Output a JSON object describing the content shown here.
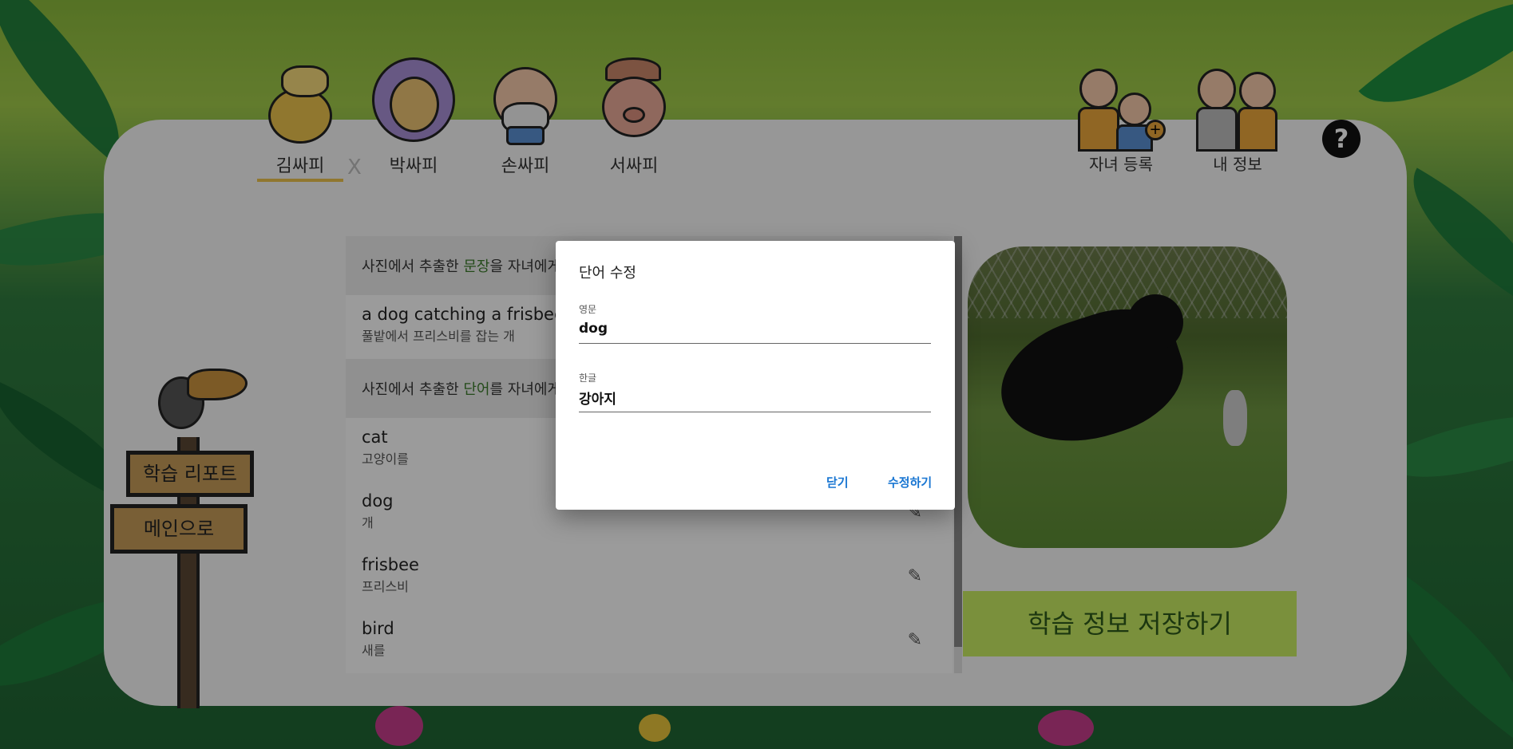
{
  "tabs": [
    {
      "name": "김싸피",
      "active": true
    },
    {
      "name": "박싸피",
      "active": false
    },
    {
      "name": "손싸피",
      "active": false
    },
    {
      "name": "서싸피",
      "active": false
    }
  ],
  "close_tab": "X",
  "family": {
    "register_child": "자녀 등록",
    "my_info": "내 정보"
  },
  "help_icon": "?",
  "sidebar": {
    "report": "학습 리포트",
    "main": "메인으로"
  },
  "sentence_section": {
    "prefix": "사진에서 추출한 ",
    "highlight": "문장",
    "suffix": "을 자녀에게 학습시키세요"
  },
  "sentence": {
    "en": "a dog catching a frisbee",
    "ko": "풀밭에서 프리스비를 잡는 개"
  },
  "word_section": {
    "prefix": "사진에서 추출한 ",
    "highlight": "단어",
    "suffix": "를 자녀에게 학습시키세요"
  },
  "words": [
    {
      "en": "cat",
      "ko": "고양이를"
    },
    {
      "en": "dog",
      "ko": "개"
    },
    {
      "en": "frisbee",
      "ko": "프리스비"
    },
    {
      "en": "bird",
      "ko": "새를"
    }
  ],
  "save_button": "학습 정보 저장하기",
  "dialog": {
    "title": "단어 수정",
    "english_label": "영문",
    "english_value": "dog",
    "korean_label": "한글",
    "korean_value": "강아지",
    "close": "닫기",
    "submit": "수정하기"
  },
  "colors": {
    "accent_green": "#c6e862",
    "tab_underline": "#e8c14c",
    "dialog_button": "#1976d2"
  }
}
